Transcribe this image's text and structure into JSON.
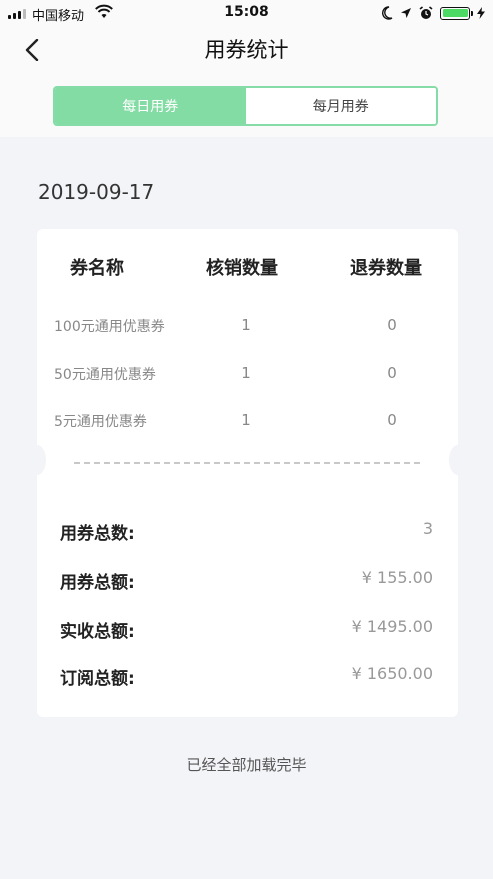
{
  "status_bar": {
    "carrier": "中国移动",
    "time": "15:08",
    "icons": [
      "signal-icon",
      "wifi-icon",
      "moon-icon",
      "location-arrow-icon",
      "alarm-icon",
      "battery-icon"
    ],
    "battery_color": "#4cd964"
  },
  "nav": {
    "title": "用券统计",
    "back_icon": "chevron-left-icon"
  },
  "segmented": {
    "tabs": [
      {
        "label": "每日用券",
        "active": true
      },
      {
        "label": "每月用券",
        "active": false
      }
    ],
    "accent": "#84dca5"
  },
  "date": "2019-09-17",
  "table": {
    "headers": [
      "券名称",
      "核销数量",
      "退券数量"
    ],
    "rows": [
      {
        "name": "100元通用优惠券",
        "used": "1",
        "refunded": "0"
      },
      {
        "name": "50元通用优惠券",
        "used": "1",
        "refunded": "0"
      },
      {
        "name": "5元通用优惠券",
        "used": "1",
        "refunded": "0"
      }
    ]
  },
  "summary": [
    {
      "label": "用券总数:",
      "value": "3"
    },
    {
      "label": "用券总额:",
      "value": "¥ 155.00"
    },
    {
      "label": "实收总额:",
      "value": "¥ 1495.00"
    },
    {
      "label": "订阅总额:",
      "value": "¥ 1650.00"
    }
  ],
  "footer": "已经全部加载完毕"
}
